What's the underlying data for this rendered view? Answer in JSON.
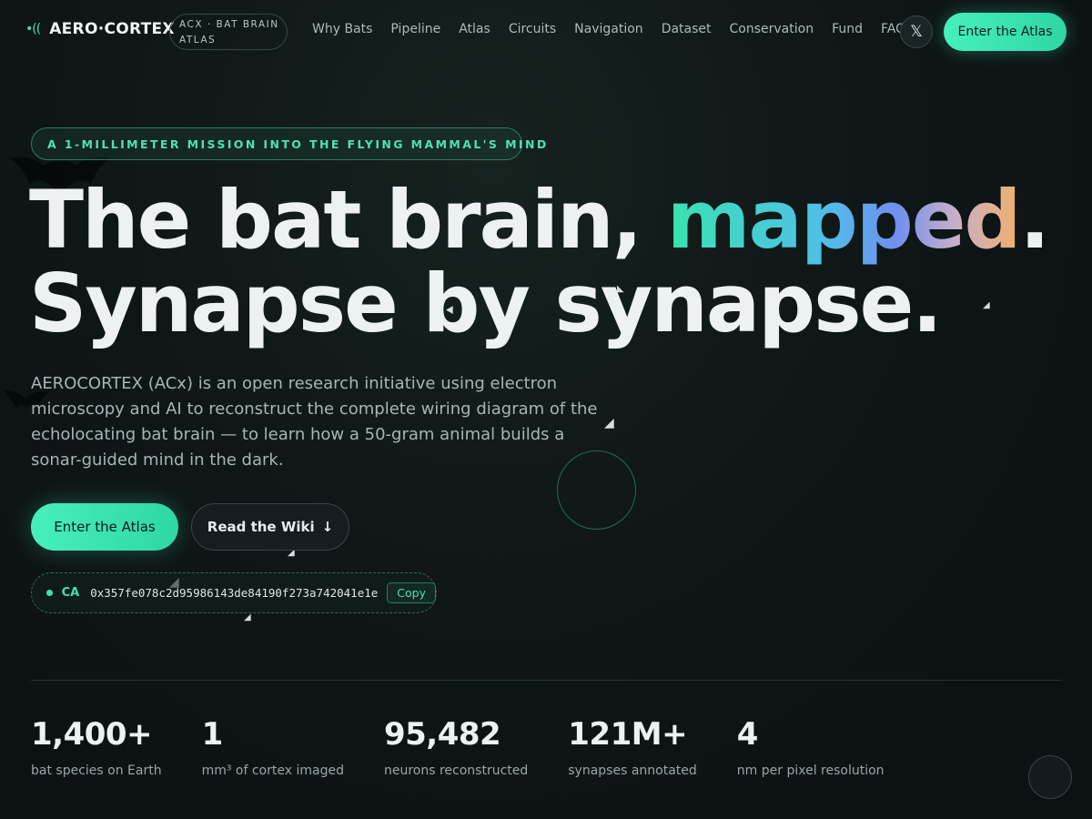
{
  "brand": {
    "name": "AERO·CORTEX",
    "tag": "ACX · BAT BRAIN ATLAS"
  },
  "nav": {
    "items": [
      "Why Bats",
      "Pipeline",
      "Atlas",
      "Circuits",
      "Navigation",
      "Dataset",
      "Conservation",
      "Fund",
      "FAQ"
    ],
    "cta": "Enter the Atlas",
    "social_icon": "x-icon"
  },
  "hero": {
    "eyebrow": "A 1-MILLIMETER MISSION INTO THE FLYING MAMMAL'S MIND",
    "title_line1_pre": "The bat brain, ",
    "title_line1_highlight": "mapped",
    "title_line1_post": ".",
    "title_line2": "Synapse by synapse.",
    "lede": "AEROCORTEX (ACx) is an open research initiative using electron microscopy and AI to reconstruct the complete wiring diagram of the echolocating bat brain — to learn how a 50-gram animal builds a sonar-guided mind in the dark.",
    "primary_button": "Enter the Atlas",
    "secondary_button": "Read the Wiki",
    "secondary_icon": "↓",
    "contract": {
      "label": "CA",
      "address": "0x357fe078c2d95986143de84190f273a742041e1e",
      "copy": "Copy"
    }
  },
  "stats": [
    {
      "value": "1,400+",
      "label": "bat species on Earth"
    },
    {
      "value": "1",
      "label": "mm³ of cortex imaged"
    },
    {
      "value": "95,482",
      "label": "neurons reconstructed"
    },
    {
      "value": "121M+",
      "label": "synapses annotated"
    },
    {
      "value": "4",
      "label": "nm per pixel resolution"
    }
  ],
  "colors": {
    "accent": "#3fe0b0",
    "background": "#0f1616"
  }
}
